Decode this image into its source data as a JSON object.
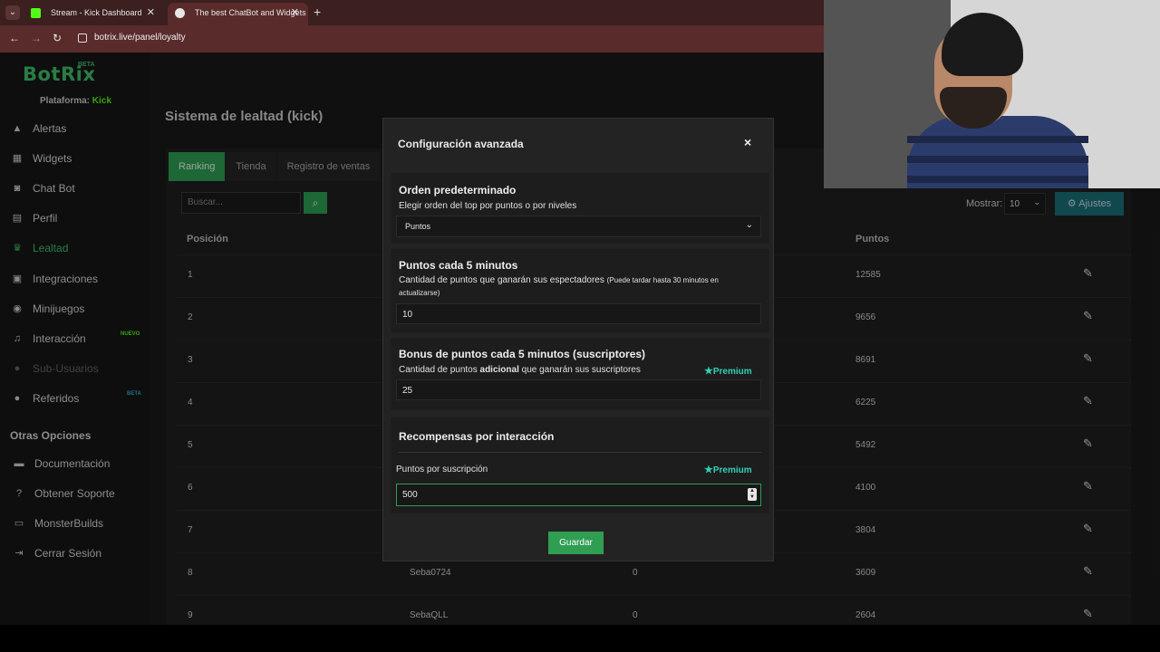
{
  "browser": {
    "tabs": [
      {
        "title": "Stream - Kick Dashboard",
        "favicon_color": "#53fc18"
      },
      {
        "title": "The best ChatBot and Widgets",
        "favicon_color": "#e6e6e6"
      }
    ],
    "url": "botrix.live/panel/loyalty"
  },
  "sidebar": {
    "logo": "BotRix",
    "logo_badge": "BETA",
    "platform_label": "Plataforma:",
    "platform_value": "Kick",
    "items": [
      {
        "label": "Alertas",
        "icon": "warning-icon"
      },
      {
        "label": "Widgets",
        "icon": "grid-icon"
      },
      {
        "label": "Chat Bot",
        "icon": "robot-icon"
      },
      {
        "label": "Perfil",
        "icon": "id-card-icon"
      },
      {
        "label": "Lealtad",
        "icon": "trophy-icon"
      },
      {
        "label": "Integraciones",
        "icon": "plug-icon"
      },
      {
        "label": "Minijuegos",
        "icon": "gamepad-icon"
      },
      {
        "label": "Interacción",
        "icon": "music-icon",
        "badge": "NUEVO"
      },
      {
        "label": "Sub-Usuarios",
        "icon": "users-icon"
      },
      {
        "label": "Referidos",
        "icon": "users-icon",
        "badge": "BETA"
      }
    ],
    "other_title": "Otras Opciones",
    "other_items": [
      {
        "label": "Documentación",
        "icon": "book-icon"
      },
      {
        "label": "Obtener Soporte",
        "icon": "help-icon"
      },
      {
        "label": "MonsterBuilds",
        "icon": "monitor-icon"
      },
      {
        "label": "Cerrar Sesión",
        "icon": "logout-icon"
      }
    ]
  },
  "main": {
    "title": "Sistema de lealtad (kick)",
    "tabs": [
      "Ranking",
      "Tienda",
      "Registro de ventas"
    ],
    "search_placeholder": "Buscar...",
    "show_label": "Mostrar:",
    "show_value": "10",
    "settings_label": "Ajustes",
    "columns": [
      "Posición",
      "Puntos"
    ],
    "rows": [
      {
        "pos": "1",
        "user": "",
        "level": "",
        "points": "12585"
      },
      {
        "pos": "2",
        "user": "",
        "level": "",
        "points": "9656"
      },
      {
        "pos": "3",
        "user": "",
        "level": "",
        "points": "8691"
      },
      {
        "pos": "4",
        "user": "",
        "level": "",
        "points": "6225"
      },
      {
        "pos": "5",
        "user": "",
        "level": "",
        "points": "5492"
      },
      {
        "pos": "6",
        "user": "",
        "level": "",
        "points": "4100"
      },
      {
        "pos": "7",
        "user": "",
        "level": "",
        "points": "3804"
      },
      {
        "pos": "8",
        "user": "Seba0724",
        "level": "0",
        "points": "3609"
      },
      {
        "pos": "9",
        "user": "SebaQLL",
        "level": "0",
        "points": "2604"
      }
    ]
  },
  "modal": {
    "title": "Configuración avanzada",
    "close": "×",
    "order": {
      "title": "Orden predeterminado",
      "desc": "Elegir orden del top por puntos o por niveles",
      "value": "Puntos"
    },
    "points5": {
      "title": "Puntos cada 5 minutos",
      "desc": "Cantidad de puntos que ganarán sus espectadores",
      "desc_small": "(Puede tardar hasta 30 minutos en actualizarse)",
      "value": "10"
    },
    "bonus5": {
      "title": "Bonus de puntos cada 5 minutos (suscriptores)",
      "desc_pre": "Cantidad de puntos ",
      "desc_bold": "adicional",
      "desc_post": " que ganarán sus suscriptores",
      "premium": "Premium",
      "value": "25"
    },
    "rewards": {
      "title": "Recompensas por interacción",
      "sub_label": "Puntos por suscripción",
      "premium": "Premium",
      "value": "500"
    },
    "save": "Guardar"
  }
}
